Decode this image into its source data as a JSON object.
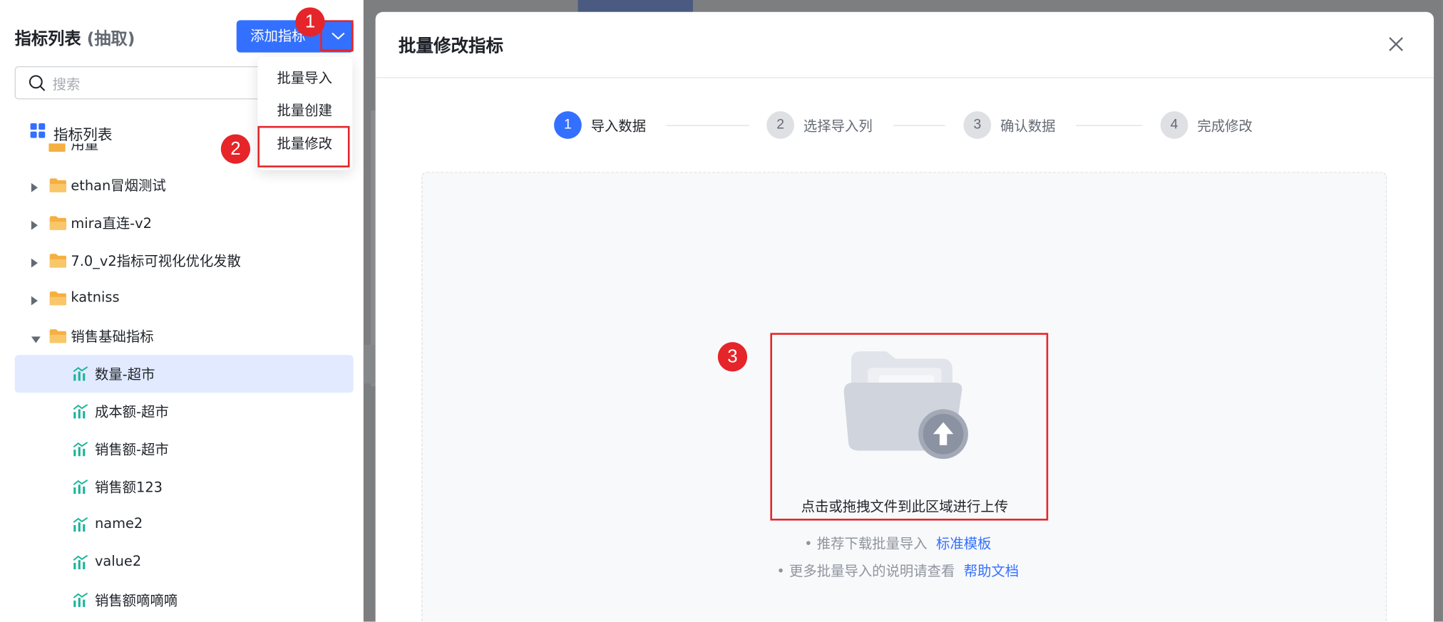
{
  "left": {
    "title": "指标列表",
    "title_suffix": "(抽取)",
    "add_button": "添加指标",
    "search_placeholder": "搜索",
    "dropdown": [
      "批量导入",
      "批量创建",
      "批量修改"
    ],
    "tree_root": "指标列表",
    "clipped_row": "用量",
    "folders": [
      "ethan冒烟测试",
      "mira直连-v2",
      "7.0_v2指标可视化优化发散",
      "katniss",
      "销售基础指标"
    ],
    "metrics": [
      "数量-超市",
      "成本额-超市",
      "销售额-超市",
      "销售额123",
      "name2",
      "value2",
      "销售额嘀嘀嘀"
    ]
  },
  "annotations": [
    "1",
    "2",
    "3"
  ],
  "modal": {
    "title": "批量修改指标",
    "steps": [
      {
        "num": "1",
        "label": "导入数据"
      },
      {
        "num": "2",
        "label": "选择导入列"
      },
      {
        "num": "3",
        "label": "确认数据"
      },
      {
        "num": "4",
        "label": "完成修改"
      }
    ],
    "upload_text": "点击或拖拽文件到此区域进行上传",
    "tip1": "• 推荐下载批量导入",
    "tip1_link": "标准模板",
    "tip2": "• 更多批量导入的说明请查看",
    "tip2_link": "帮助文档"
  },
  "colors": {
    "accent": "#3370ff",
    "annotation": "#e5252a",
    "folder": "#f5b041",
    "metric_icon": "#1bb39a"
  }
}
